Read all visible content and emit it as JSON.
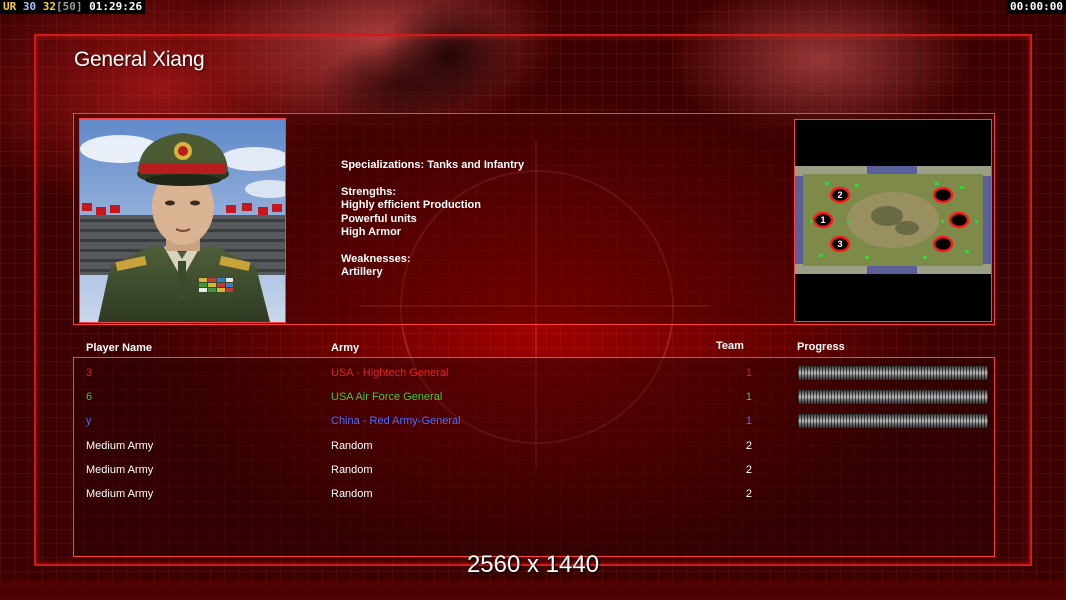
{
  "hud": {
    "label": "UR",
    "value1": "30",
    "value2": "32",
    "value3": "[50]",
    "elapsed": "01:29:26",
    "timer": "00:00:00"
  },
  "general": {
    "name": "General Xiang",
    "description_lines": [
      "Specializations: Tanks and Infantry",
      "",
      "Strengths:",
      "Highly efficient Production",
      "Powerful units",
      "High Armor",
      "",
      "Weaknesses:",
      "Artillery"
    ]
  },
  "map": {
    "start_positions": [
      "2",
      "1",
      "3"
    ]
  },
  "table": {
    "headers": {
      "player_name": "Player Name",
      "army": "Army",
      "team": "Team",
      "progress": "Progress"
    },
    "rows": [
      {
        "name": "3",
        "army": "USA - Hightech General",
        "team": "1",
        "color": "#e02424",
        "progress": 1.0
      },
      {
        "name": "6",
        "army": "USA Air Force General",
        "team": "1",
        "color": "#3ecb3e",
        "progress": 1.0
      },
      {
        "name": "y",
        "army": "China - Red Army-General",
        "team": "1",
        "color": "#4a6cff",
        "progress": 1.0
      },
      {
        "name": "Medium Army",
        "army": "Random",
        "team": "2",
        "color": "#ffffff"
      },
      {
        "name": "Medium Army",
        "army": "Random",
        "team": "2",
        "color": "#ffffff"
      },
      {
        "name": "Medium Army",
        "army": "Random",
        "team": "2",
        "color": "#ffffff"
      }
    ]
  },
  "resolution_label": "2560 x 1440"
}
